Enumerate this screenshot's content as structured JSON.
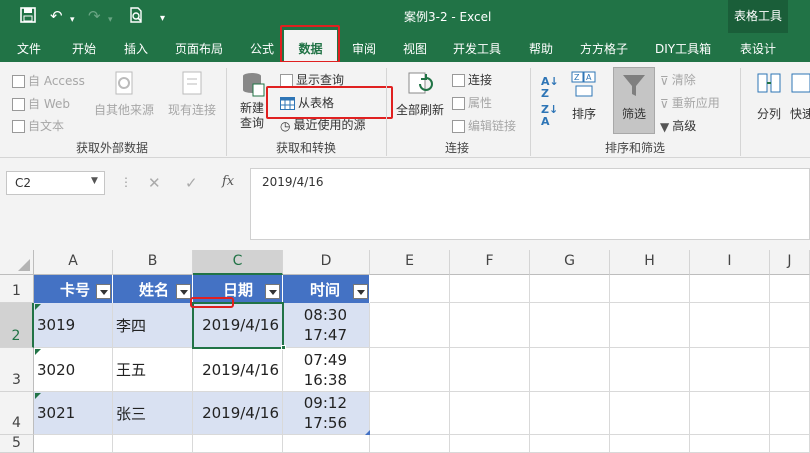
{
  "titlebar": {
    "title": "案例3-2  -  Excel",
    "context_tab": "表格工具"
  },
  "tabs": [
    "文件",
    "开始",
    "插入",
    "页面布局",
    "公式",
    "数据",
    "审阅",
    "视图",
    "开发工具",
    "帮助",
    "方方格子",
    "DIY工具箱",
    "表设计"
  ],
  "ribbon": {
    "ext": {
      "access": "自 Access",
      "web": "自 Web",
      "text": "自文本",
      "other": "自其他来源",
      "existing": "现有连接",
      "label": "获取外部数据"
    },
    "transform": {
      "new_query": "新建\n查询",
      "show_query": "显示查询",
      "from_table": "从表格",
      "recent": "最近使用的源",
      "label": "获取和转换"
    },
    "conn": {
      "refresh_all": "全部刷新",
      "connections": "连接",
      "properties": "属性",
      "edit_links": "编辑链接",
      "label": "连接"
    },
    "sort": {
      "sort": "排序",
      "filter": "筛选",
      "clear": "清除",
      "reapply": "重新应用",
      "advanced": "高级",
      "label": "排序和筛选"
    },
    "tools": {
      "split": "分列",
      "quick": "快速"
    }
  },
  "formula": {
    "name_box": "C2",
    "value": "2019/4/16",
    "fx": "fx"
  },
  "columns": [
    "A",
    "B",
    "C",
    "D",
    "E",
    "F",
    "G",
    "H",
    "I",
    "J"
  ],
  "rows": [
    "1",
    "2",
    "3",
    "4",
    "5"
  ],
  "table": {
    "headers": [
      "卡号",
      "姓名",
      "日期",
      "时间"
    ],
    "rows": [
      {
        "id": "3019",
        "name": "李四",
        "date": "2019/4/16",
        "t1": "08:30",
        "t2": "17:47"
      },
      {
        "id": "3020",
        "name": "王五",
        "date": "2019/4/16",
        "t1": "07:49",
        "t2": "16:38"
      },
      {
        "id": "3021",
        "name": "张三",
        "date": "2019/4/16",
        "t1": "09:12",
        "t2": "17:56"
      }
    ]
  },
  "colors": {
    "excel_green": "#217346",
    "header_blue": "#4472c4",
    "band": "#d9e1f2",
    "highlight": "#e02020"
  }
}
